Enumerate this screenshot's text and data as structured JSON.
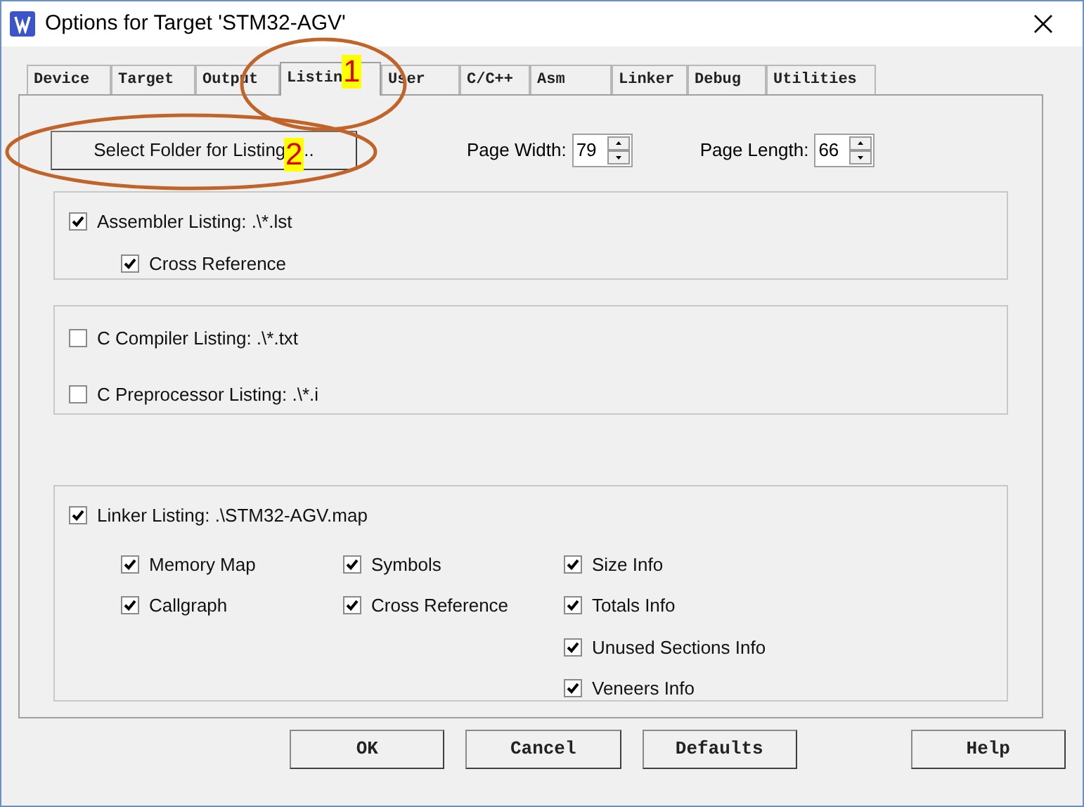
{
  "window": {
    "title": "Options for Target 'STM32-AGV'"
  },
  "tabs": [
    {
      "label": "Device",
      "selected": false
    },
    {
      "label": "Target",
      "selected": false
    },
    {
      "label": "Output",
      "selected": false
    },
    {
      "label": "Listin",
      "selected": true
    },
    {
      "label": "User",
      "selected": false
    },
    {
      "label": "C/C++",
      "selected": false
    },
    {
      "label": "Asm",
      "selected": false
    },
    {
      "label": "Linker",
      "selected": false
    },
    {
      "label": "Debug",
      "selected": false
    },
    {
      "label": "Utilities",
      "selected": false
    }
  ],
  "select_folder_button": {
    "label": "Select Folder for Listing",
    "suffix": ".."
  },
  "page_width": {
    "label": "Page Width:",
    "value": "79"
  },
  "page_length": {
    "label": "Page Length:",
    "value": "66"
  },
  "groups": [
    {
      "items": [
        {
          "label": "Assembler Listing:  .\\*.lst",
          "checked": true,
          "children": [
            {
              "label": "Cross Reference",
              "checked": true
            }
          ]
        }
      ]
    },
    {
      "items": [
        {
          "label": "C Compiler Listing:  .\\*.txt",
          "checked": false
        },
        {
          "label": "C Preprocessor Listing:  .\\*.i",
          "checked": false
        }
      ]
    }
  ],
  "linker": {
    "label": "Linker Listing:  .\\STM32-AGV.map",
    "checked": true,
    "columns": [
      [
        {
          "label": "Memory Map",
          "checked": true
        },
        {
          "label": "Callgraph",
          "checked": true
        }
      ],
      [
        {
          "label": "Symbols",
          "checked": true
        },
        {
          "label": "Cross Reference",
          "checked": true
        }
      ],
      [
        {
          "label": "Size Info",
          "checked": true
        },
        {
          "label": "Totals Info",
          "checked": true
        },
        {
          "label": "Unused Sections Info",
          "checked": true
        },
        {
          "label": "Veneers Info",
          "checked": true
        }
      ]
    ]
  },
  "buttons": [
    "OK",
    "Cancel",
    "Defaults",
    "Help"
  ],
  "annotations": [
    "1",
    "2"
  ]
}
